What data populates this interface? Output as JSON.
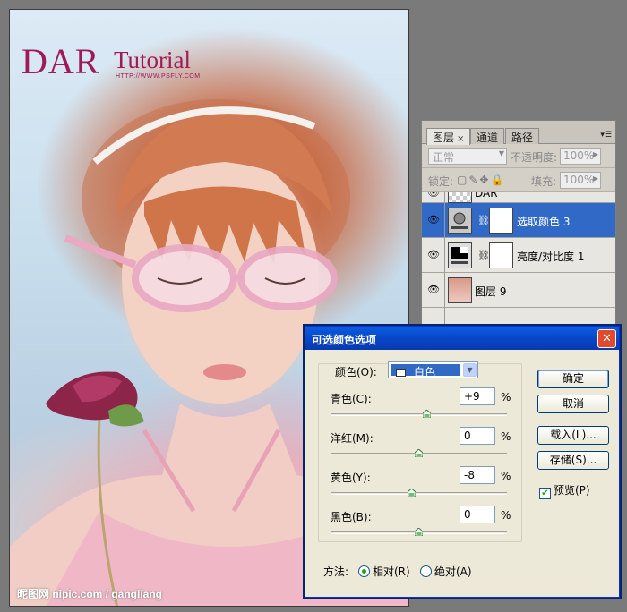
{
  "canvas": {
    "logo_main": "DAR",
    "logo_tutorial": "Tutorial",
    "logo_url": "HTTP://WWW.PSFLY.COM",
    "watermark": "昵图网 nipic.com / gangliang"
  },
  "layers_panel": {
    "tabs": [
      {
        "label": "图层",
        "close": "×"
      },
      {
        "label": "通道"
      },
      {
        "label": "路径"
      }
    ],
    "menu_icon": "panel-menu-icon",
    "blend_mode": "正常",
    "opacity_label": "不透明度:",
    "opacity_value": "100%",
    "lock_label": "锁定:",
    "fill_label": "填充:",
    "fill_value": "100%",
    "layers": [
      {
        "name": "DAR",
        "visible": true,
        "selected": false
      },
      {
        "name": "选取颜色 3",
        "visible": true,
        "selected": true
      },
      {
        "name": "亮度/对比度 1",
        "visible": true,
        "selected": false
      },
      {
        "name": "图层 9",
        "visible": true,
        "selected": false
      }
    ]
  },
  "dialog": {
    "title": "可选颜色选项",
    "close": "✕",
    "colors_label": "颜色(O):",
    "colors_value": "白色",
    "sliders": [
      {
        "label": "青色(C):",
        "value": "+9",
        "unit": "%",
        "level": 9
      },
      {
        "label": "洋红(M):",
        "value": "0",
        "unit": "%",
        "level": 0
      },
      {
        "label": "黄色(Y):",
        "value": "-8",
        "unit": "%",
        "level": -8
      },
      {
        "label": "黑色(B):",
        "value": "0",
        "unit": "%",
        "level": 0
      }
    ],
    "buttons": {
      "ok": "确定",
      "cancel": "取消",
      "load": "载入(L)...",
      "save": "存储(S)..."
    },
    "preview_label": "预览(P)",
    "preview_checked": true,
    "method_label": "方法:",
    "method_relative": "相对(R)",
    "method_absolute": "绝对(A)",
    "method_selected": "relative"
  }
}
